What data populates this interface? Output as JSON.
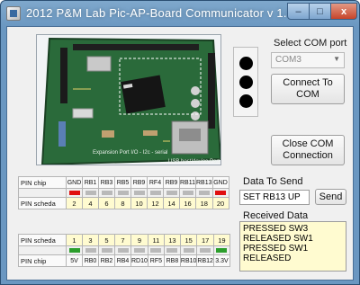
{
  "window": {
    "title": "2012 P&M Lab Pic-AP-Board Communicator v 1.0",
    "controls": {
      "minimize": "–",
      "maximize": "□",
      "close": "x"
    }
  },
  "board_photo": {
    "labels": [
      "Expansion Port I/O - I2c - serial",
      "USB host/device Port"
    ]
  },
  "com": {
    "label": "Select COM port",
    "selected": "COM3",
    "connect_button": "Connect To COM",
    "close_button": "Close COM Connection"
  },
  "send": {
    "label": "Data To Send",
    "value": "SET RB13 UP",
    "button": "Send"
  },
  "received": {
    "label": "Received Data",
    "lines": [
      "PRESSED SW3",
      "RELEASED SW1",
      "PRESSED SW1",
      "RELEASED"
    ]
  },
  "top_pins": {
    "chip_label": "PIN chip",
    "scheda_label": "PIN scheda",
    "chip": [
      "GND",
      "RB1",
      "RB3",
      "RB5",
      "RB9",
      "RF4",
      "RB9",
      "RB11",
      "RB13",
      "GND"
    ],
    "scheda": [
      "2",
      "4",
      "6",
      "8",
      "10",
      "12",
      "14",
      "16",
      "18",
      "20"
    ],
    "state": [
      "red",
      "grey",
      "grey",
      "grey",
      "grey",
      "grey",
      "grey",
      "grey",
      "grey",
      "red"
    ]
  },
  "bottom_pins": {
    "scheda_label": "PIN scheda",
    "chip_label": "PIN chip",
    "scheda": [
      "1",
      "3",
      "5",
      "7",
      "9",
      "11",
      "13",
      "15",
      "17",
      "19"
    ],
    "chip": [
      "5V",
      "RB0",
      "RB2",
      "RB4",
      "RD10",
      "RF5",
      "RB8",
      "RB10",
      "RB12",
      "3.3V"
    ],
    "state": [
      "green",
      "grey",
      "grey",
      "grey",
      "grey",
      "grey",
      "grey",
      "grey",
      "grey",
      "green"
    ]
  },
  "colors": {
    "title_bar": "#6a97c1",
    "pin_number_fill": "#fffbd0",
    "state_on_red": "#e01010",
    "state_on_green": "#2c9e2c",
    "state_off": "#b9b9b9"
  }
}
